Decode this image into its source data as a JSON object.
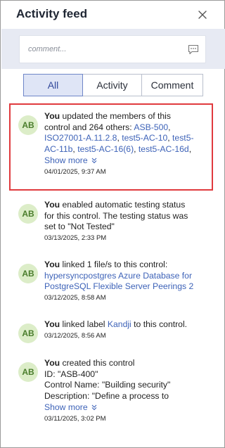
{
  "header": {
    "title": "Activity feed"
  },
  "comment": {
    "placeholder": "comment..."
  },
  "tabs": [
    {
      "label": "All",
      "selected": true
    },
    {
      "label": "Activity",
      "selected": false
    },
    {
      "label": "Comment",
      "selected": false
    }
  ],
  "feed": [
    {
      "avatar": "AB",
      "actor": "You",
      "lines": [
        {
          "parts": [
            {
              "t": " updated the members of this"
            }
          ]
        },
        {
          "parts": [
            {
              "t": "control and 264 others: "
            },
            {
              "t": "ASB-500",
              "link": true
            },
            {
              "t": ","
            }
          ]
        },
        {
          "parts": [
            {
              "t": "ISO27001-A.11.2.8",
              "link": true
            },
            {
              "t": ", "
            },
            {
              "t": "test5-AC-10",
              "link": true
            },
            {
              "t": ", "
            },
            {
              "t": "test5-",
              "link": true
            }
          ]
        },
        {
          "parts": [
            {
              "t": "AC-11b",
              "link": true
            },
            {
              "t": ", "
            },
            {
              "t": "test5-AC-16(6)",
              "link": true
            },
            {
              "t": ", "
            },
            {
              "t": "test5-AC-16d",
              "link": true
            },
            {
              "t": ","
            }
          ]
        }
      ],
      "show_more": "Show more",
      "time": "04/01/2025, 9:37 AM"
    },
    {
      "avatar": "AB",
      "actor": "You",
      "lines": [
        {
          "parts": [
            {
              "t": " enabled automatic testing status"
            }
          ]
        },
        {
          "parts": [
            {
              "t": "for this control. The testing status was"
            }
          ]
        },
        {
          "parts": [
            {
              "t": "set to \"Not Tested\""
            }
          ]
        }
      ],
      "time": "03/13/2025, 2:33 PM"
    },
    {
      "avatar": "AB",
      "actor": "You",
      "lines": [
        {
          "parts": [
            {
              "t": " linked 1 file/s to this control:"
            }
          ]
        },
        {
          "parts": [
            {
              "t": "hypersyncpostgres Azure Database for",
              "link": true
            }
          ]
        },
        {
          "parts": [
            {
              "t": "PostgreSQL Flexible Server Peerings 2",
              "link": true
            }
          ]
        }
      ],
      "time": "03/12/2025, 8:58 AM"
    },
    {
      "avatar": "AB",
      "actor": "You",
      "lines": [
        {
          "parts": [
            {
              "t": " linked label "
            },
            {
              "t": "Kandji",
              "link": true
            },
            {
              "t": " to this control."
            }
          ]
        }
      ],
      "time": "03/12/2025, 8:56 AM"
    },
    {
      "avatar": "AB",
      "actor": "You",
      "lines": [
        {
          "parts": [
            {
              "t": " created this control"
            }
          ]
        },
        {
          "parts": [
            {
              "t": "ID: \"ASB-400\""
            }
          ]
        },
        {
          "parts": [
            {
              "t": "Control Name: \"Building security\""
            }
          ]
        },
        {
          "parts": [
            {
              "t": "Description: \"Define a process to"
            }
          ]
        }
      ],
      "show_more": "Show more",
      "time": "03/11/2025, 3:02 PM"
    }
  ],
  "icons": {
    "close": "close-icon",
    "comment": "chat-bubble-icon",
    "chevron": "double-chevron-down-icon"
  },
  "colors": {
    "link": "#3e63b8",
    "highlight": "#e03a3e",
    "avatar_bg": "#dcedc8",
    "avatar_fg": "#4a7d2c",
    "tab_selected_bg": "#dfe5f6"
  }
}
